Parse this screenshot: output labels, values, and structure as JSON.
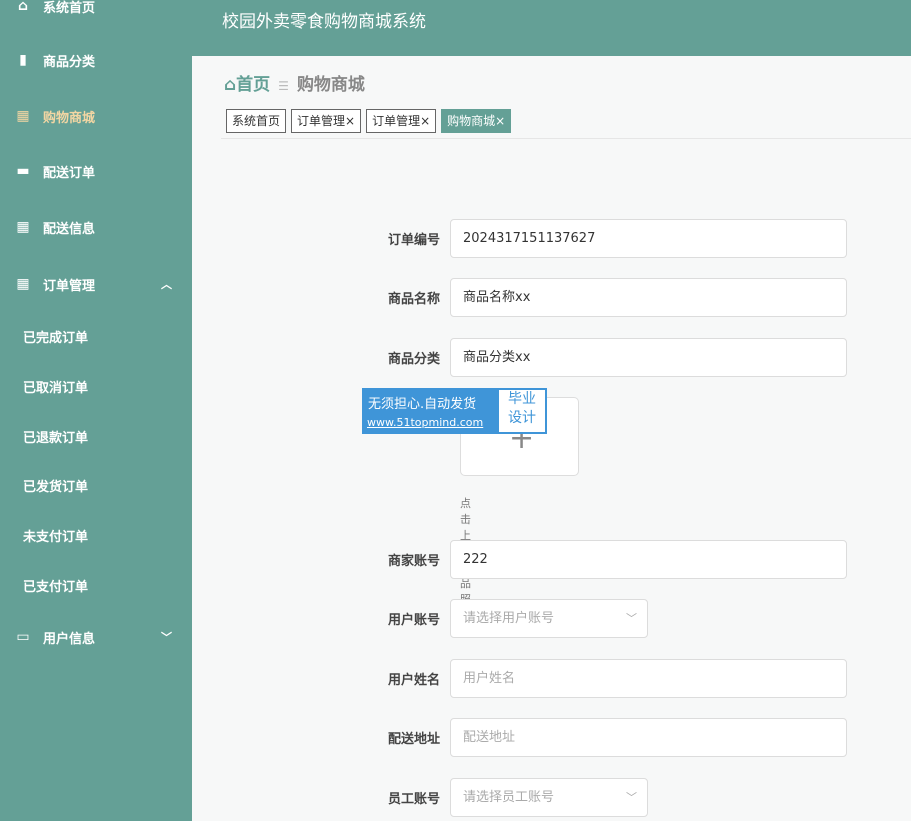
{
  "app_title": "校园外卖零食购物商城系统",
  "sidebar": {
    "items": [
      {
        "label": "系统首页",
        "icon": "home-icon"
      },
      {
        "label": "商品分类",
        "icon": "bar-chart-icon"
      },
      {
        "label": "购物商城",
        "icon": "grid-icon"
      },
      {
        "label": "配送订单",
        "icon": "briefcase-icon"
      },
      {
        "label": "配送信息",
        "icon": "grid-icon"
      },
      {
        "label": "订单管理",
        "icon": "grid-icon"
      },
      {
        "label": "用户信息",
        "icon": "card-icon"
      }
    ],
    "sub_items": [
      "已完成订单",
      "已取消订单",
      "已退款订单",
      "已发货订单",
      "未支付订单",
      "已支付订单"
    ]
  },
  "breadcrumb": {
    "home": "首页",
    "current": "购物商城"
  },
  "tabs": [
    "系统首页",
    "订单管理×",
    "订单管理×",
    "购物商城×"
  ],
  "form": {
    "order_no": {
      "label": "订单编号",
      "value": "2024317151137627"
    },
    "product_name": {
      "label": "商品名称",
      "value": "商品名称xx"
    },
    "category": {
      "label": "商品分类",
      "value": "商品分类xx"
    },
    "upload_hint": "点击上传商品照片",
    "merchant": {
      "label": "商家账号",
      "value": "222"
    },
    "user_account": {
      "label": "用户账号",
      "placeholder": "请选择用户账号"
    },
    "user_name": {
      "label": "用户姓名",
      "placeholder": "用户姓名"
    },
    "address": {
      "label": "配送地址",
      "placeholder": "配送地址"
    },
    "staff": {
      "label": "员工账号",
      "placeholder": "请选择员工账号"
    }
  },
  "watermark": {
    "line1": "无须担心.自动发货",
    "line2": "www.51topmind.com",
    "badge1": "毕业",
    "badge2": "设计"
  }
}
